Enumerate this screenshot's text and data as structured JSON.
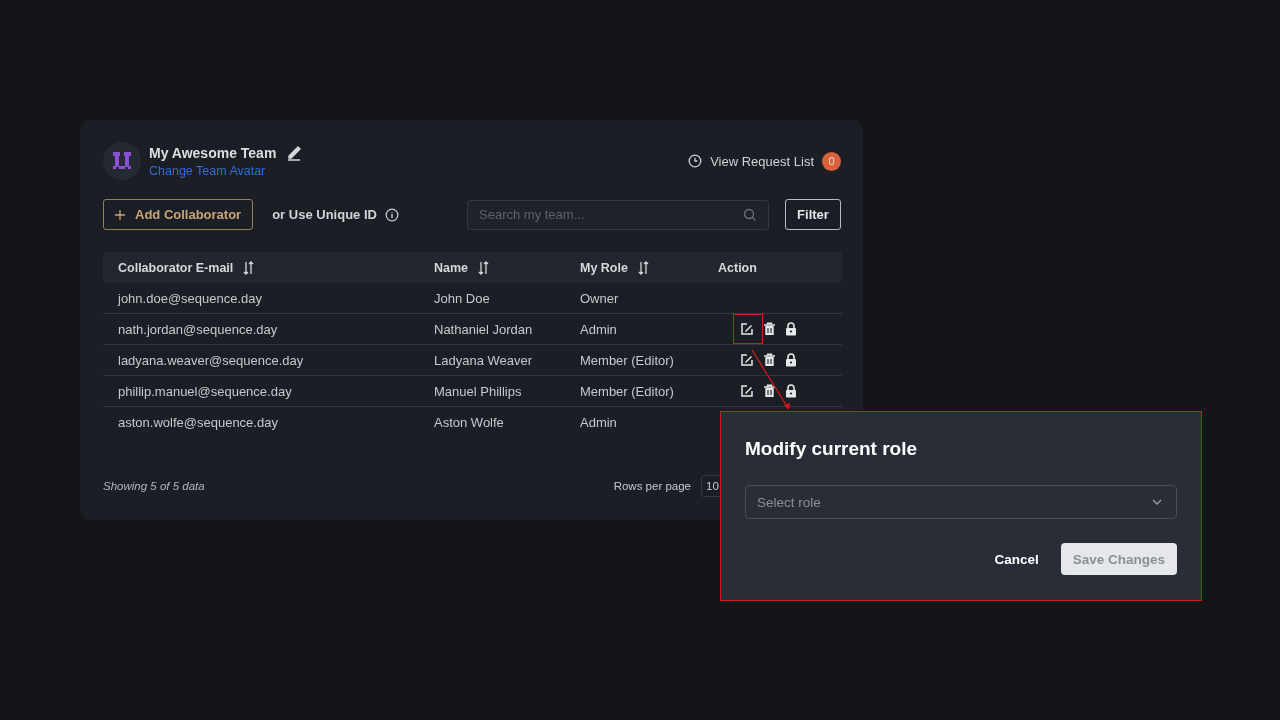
{
  "team": {
    "name": "My Awesome Team",
    "change_avatar": "Change Team Avatar"
  },
  "request_list": {
    "label": "View Request List",
    "count": "0"
  },
  "toolbar": {
    "add_button": "Add Collaborator",
    "unique_id": "or Use Unique ID",
    "search": {
      "placeholder": "Search my team..."
    },
    "filter_button": "Filter"
  },
  "table": {
    "columns": [
      {
        "label": "Collaborator E-mail",
        "sortable": true
      },
      {
        "label": "Name",
        "sortable": true
      },
      {
        "label": "My Role",
        "sortable": true
      },
      {
        "label": "Action",
        "sortable": false
      }
    ],
    "rows": [
      {
        "email": "john.doe@sequence.day",
        "name": "John Doe",
        "role": "Owner",
        "actions": false,
        "highlighted": false
      },
      {
        "email": "nath.jordan@sequence.day",
        "name": "Nathaniel Jordan",
        "role": "Admin",
        "actions": true,
        "highlighted": true
      },
      {
        "email": "ladyana.weaver@sequence.day",
        "name": "Ladyana Weaver",
        "role": "Member (Editor)",
        "actions": true,
        "highlighted": false
      },
      {
        "email": "phillip.manuel@sequence.day",
        "name": "Manuel Phillips",
        "role": "Member (Editor)",
        "actions": true,
        "highlighted": false
      },
      {
        "email": "aston.wolfe@sequence.day",
        "name": "Aston Wolfe",
        "role": "Admin",
        "actions": false,
        "highlighted": false
      }
    ]
  },
  "footer": {
    "showing": "Showing 5 of 5 data",
    "rows_per_page": "Rows per page",
    "rows_value": "10"
  },
  "dialog": {
    "title": "Modify current role",
    "select": {
      "placeholder": "Select role"
    },
    "cancel": "Cancel",
    "save": {
      "label": "Save Changes",
      "disabled": true
    }
  }
}
